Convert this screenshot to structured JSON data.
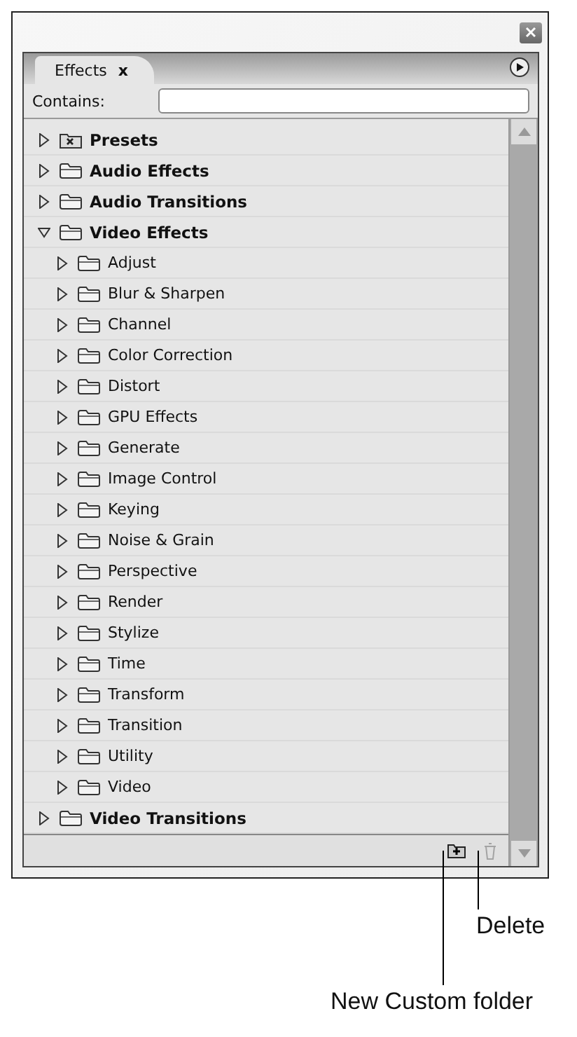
{
  "panel": {
    "tab": {
      "label": "Effects",
      "close": "x",
      "selected": true
    },
    "search": {
      "label": "Contains:"
    }
  },
  "tree": [
    {
      "label": "Presets",
      "kind": "preset",
      "expanded": false
    },
    {
      "label": "Audio Effects",
      "kind": "folder",
      "expanded": false
    },
    {
      "label": "Audio Transitions",
      "kind": "folder",
      "expanded": false
    },
    {
      "label": "Video Effects",
      "kind": "folder",
      "expanded": true,
      "children": [
        {
          "label": "Adjust",
          "kind": "folder",
          "expanded": false
        },
        {
          "label": "Blur & Sharpen",
          "kind": "folder",
          "expanded": false
        },
        {
          "label": "Channel",
          "kind": "folder",
          "expanded": false
        },
        {
          "label": "Color Correction",
          "kind": "folder",
          "expanded": false
        },
        {
          "label": "Distort",
          "kind": "folder",
          "expanded": false
        },
        {
          "label": "GPU Effects",
          "kind": "folder",
          "expanded": false
        },
        {
          "label": "Generate",
          "kind": "folder",
          "expanded": false
        },
        {
          "label": "Image Control",
          "kind": "folder",
          "expanded": false
        },
        {
          "label": "Keying",
          "kind": "folder",
          "expanded": false
        },
        {
          "label": "Noise & Grain",
          "kind": "folder",
          "expanded": false
        },
        {
          "label": "Perspective",
          "kind": "folder",
          "expanded": false
        },
        {
          "label": "Render",
          "kind": "folder",
          "expanded": false
        },
        {
          "label": "Stylize",
          "kind": "folder",
          "expanded": false
        },
        {
          "label": "Time",
          "kind": "folder",
          "expanded": false
        },
        {
          "label": "Transform",
          "kind": "folder",
          "expanded": false
        },
        {
          "label": "Transition",
          "kind": "folder",
          "expanded": false
        },
        {
          "label": "Utility",
          "kind": "folder",
          "expanded": false
        },
        {
          "label": "Video",
          "kind": "folder",
          "expanded": false
        }
      ]
    },
    {
      "label": "Video Transitions",
      "kind": "folder",
      "expanded": false
    }
  ],
  "footer": {
    "delete_disabled": true
  },
  "callouts": [
    {
      "label": "Delete"
    },
    {
      "label": "New Custom folder"
    }
  ]
}
